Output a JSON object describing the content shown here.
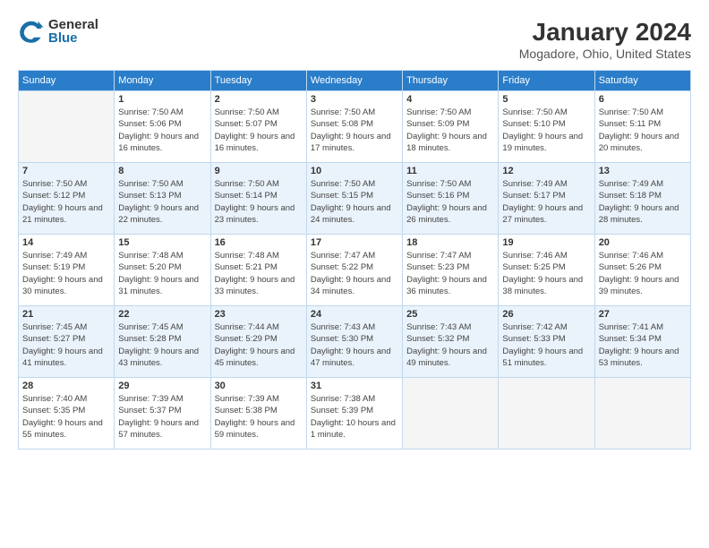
{
  "logo": {
    "general": "General",
    "blue": "Blue"
  },
  "title": "January 2024",
  "location": "Mogadore, Ohio, United States",
  "days_of_week": [
    "Sunday",
    "Monday",
    "Tuesday",
    "Wednesday",
    "Thursday",
    "Friday",
    "Saturday"
  ],
  "weeks": [
    [
      {
        "day": "",
        "empty": true
      },
      {
        "day": "1",
        "sunrise": "7:50 AM",
        "sunset": "5:06 PM",
        "daylight": "9 hours and 16 minutes."
      },
      {
        "day": "2",
        "sunrise": "7:50 AM",
        "sunset": "5:07 PM",
        "daylight": "9 hours and 16 minutes."
      },
      {
        "day": "3",
        "sunrise": "7:50 AM",
        "sunset": "5:08 PM",
        "daylight": "9 hours and 17 minutes."
      },
      {
        "day": "4",
        "sunrise": "7:50 AM",
        "sunset": "5:09 PM",
        "daylight": "9 hours and 18 minutes."
      },
      {
        "day": "5",
        "sunrise": "7:50 AM",
        "sunset": "5:10 PM",
        "daylight": "9 hours and 19 minutes."
      },
      {
        "day": "6",
        "sunrise": "7:50 AM",
        "sunset": "5:11 PM",
        "daylight": "9 hours and 20 minutes."
      }
    ],
    [
      {
        "day": "7",
        "sunrise": "7:50 AM",
        "sunset": "5:12 PM",
        "daylight": "9 hours and 21 minutes."
      },
      {
        "day": "8",
        "sunrise": "7:50 AM",
        "sunset": "5:13 PM",
        "daylight": "9 hours and 22 minutes."
      },
      {
        "day": "9",
        "sunrise": "7:50 AM",
        "sunset": "5:14 PM",
        "daylight": "9 hours and 23 minutes."
      },
      {
        "day": "10",
        "sunrise": "7:50 AM",
        "sunset": "5:15 PM",
        "daylight": "9 hours and 24 minutes."
      },
      {
        "day": "11",
        "sunrise": "7:50 AM",
        "sunset": "5:16 PM",
        "daylight": "9 hours and 26 minutes."
      },
      {
        "day": "12",
        "sunrise": "7:49 AM",
        "sunset": "5:17 PM",
        "daylight": "9 hours and 27 minutes."
      },
      {
        "day": "13",
        "sunrise": "7:49 AM",
        "sunset": "5:18 PM",
        "daylight": "9 hours and 28 minutes."
      }
    ],
    [
      {
        "day": "14",
        "sunrise": "7:49 AM",
        "sunset": "5:19 PM",
        "daylight": "9 hours and 30 minutes."
      },
      {
        "day": "15",
        "sunrise": "7:48 AM",
        "sunset": "5:20 PM",
        "daylight": "9 hours and 31 minutes."
      },
      {
        "day": "16",
        "sunrise": "7:48 AM",
        "sunset": "5:21 PM",
        "daylight": "9 hours and 33 minutes."
      },
      {
        "day": "17",
        "sunrise": "7:47 AM",
        "sunset": "5:22 PM",
        "daylight": "9 hours and 34 minutes."
      },
      {
        "day": "18",
        "sunrise": "7:47 AM",
        "sunset": "5:23 PM",
        "daylight": "9 hours and 36 minutes."
      },
      {
        "day": "19",
        "sunrise": "7:46 AM",
        "sunset": "5:25 PM",
        "daylight": "9 hours and 38 minutes."
      },
      {
        "day": "20",
        "sunrise": "7:46 AM",
        "sunset": "5:26 PM",
        "daylight": "9 hours and 39 minutes."
      }
    ],
    [
      {
        "day": "21",
        "sunrise": "7:45 AM",
        "sunset": "5:27 PM",
        "daylight": "9 hours and 41 minutes."
      },
      {
        "day": "22",
        "sunrise": "7:45 AM",
        "sunset": "5:28 PM",
        "daylight": "9 hours and 43 minutes."
      },
      {
        "day": "23",
        "sunrise": "7:44 AM",
        "sunset": "5:29 PM",
        "daylight": "9 hours and 45 minutes."
      },
      {
        "day": "24",
        "sunrise": "7:43 AM",
        "sunset": "5:30 PM",
        "daylight": "9 hours and 47 minutes."
      },
      {
        "day": "25",
        "sunrise": "7:43 AM",
        "sunset": "5:32 PM",
        "daylight": "9 hours and 49 minutes."
      },
      {
        "day": "26",
        "sunrise": "7:42 AM",
        "sunset": "5:33 PM",
        "daylight": "9 hours and 51 minutes."
      },
      {
        "day": "27",
        "sunrise": "7:41 AM",
        "sunset": "5:34 PM",
        "daylight": "9 hours and 53 minutes."
      }
    ],
    [
      {
        "day": "28",
        "sunrise": "7:40 AM",
        "sunset": "5:35 PM",
        "daylight": "9 hours and 55 minutes."
      },
      {
        "day": "29",
        "sunrise": "7:39 AM",
        "sunset": "5:37 PM",
        "daylight": "9 hours and 57 minutes."
      },
      {
        "day": "30",
        "sunrise": "7:39 AM",
        "sunset": "5:38 PM",
        "daylight": "9 hours and 59 minutes."
      },
      {
        "day": "31",
        "sunrise": "7:38 AM",
        "sunset": "5:39 PM",
        "daylight": "10 hours and 1 minute."
      },
      {
        "day": "",
        "empty": true
      },
      {
        "day": "",
        "empty": true
      },
      {
        "day": "",
        "empty": true
      }
    ]
  ],
  "labels": {
    "sunrise": "Sunrise:",
    "sunset": "Sunset:",
    "daylight": "Daylight:"
  }
}
